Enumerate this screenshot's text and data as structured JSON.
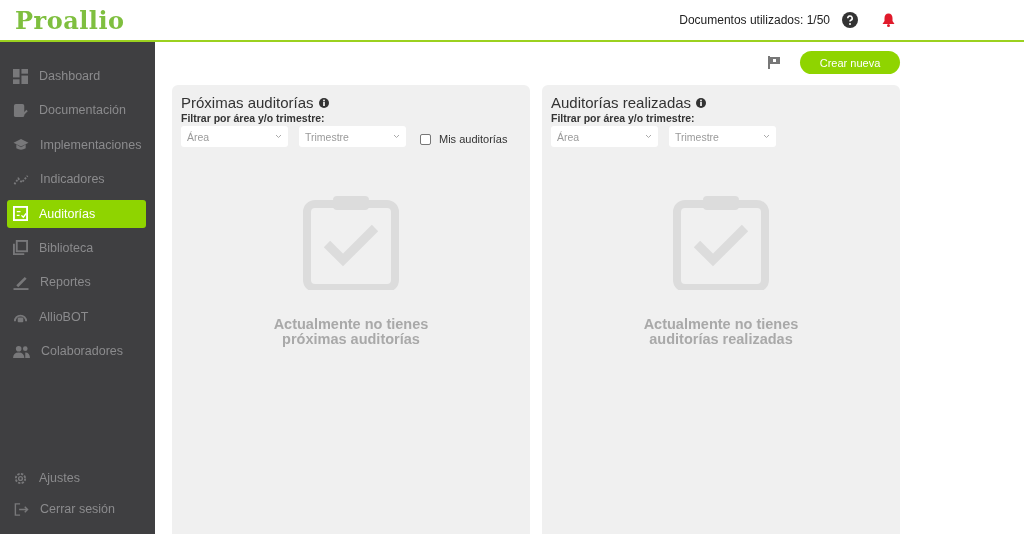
{
  "header": {
    "logo": "Proallio",
    "usage": "Documentos utilizados: 1/50"
  },
  "sidebar": {
    "items": [
      {
        "label": "Dashboard",
        "selected": false
      },
      {
        "label": "Documentación",
        "selected": false
      },
      {
        "label": "Implementaciones",
        "selected": false
      },
      {
        "label": "Indicadores",
        "selected": false
      },
      {
        "label": "Auditorías",
        "selected": true
      },
      {
        "label": "Biblioteca",
        "selected": false
      },
      {
        "label": "Reportes",
        "selected": false
      },
      {
        "label": "AllioBOT",
        "selected": false
      },
      {
        "label": "Colaboradores",
        "selected": false
      }
    ],
    "bottom_items": [
      {
        "label": "Ajustes"
      },
      {
        "label": "Cerrar sesión"
      }
    ]
  },
  "toolbar": {
    "create_button": "Crear nueva"
  },
  "panels": [
    {
      "title": "Próximas auditorías",
      "filter_label": "Filtrar por área y/o trimestre:",
      "selects": [
        {
          "placeholder": "Área"
        },
        {
          "placeholder": "Trimestre"
        }
      ],
      "checkbox": {
        "label": "Mis auditorías",
        "checked": false
      },
      "empty_message": "Actualmente no tienes próximas auditorías"
    },
    {
      "title": "Auditorías realizadas",
      "filter_label": "Filtrar por área y/o trimestre:",
      "selects": [
        {
          "placeholder": "Área"
        },
        {
          "placeholder": "Trimestre"
        }
      ],
      "empty_message": "Actualmente no tienes auditorías realizadas"
    }
  ]
}
